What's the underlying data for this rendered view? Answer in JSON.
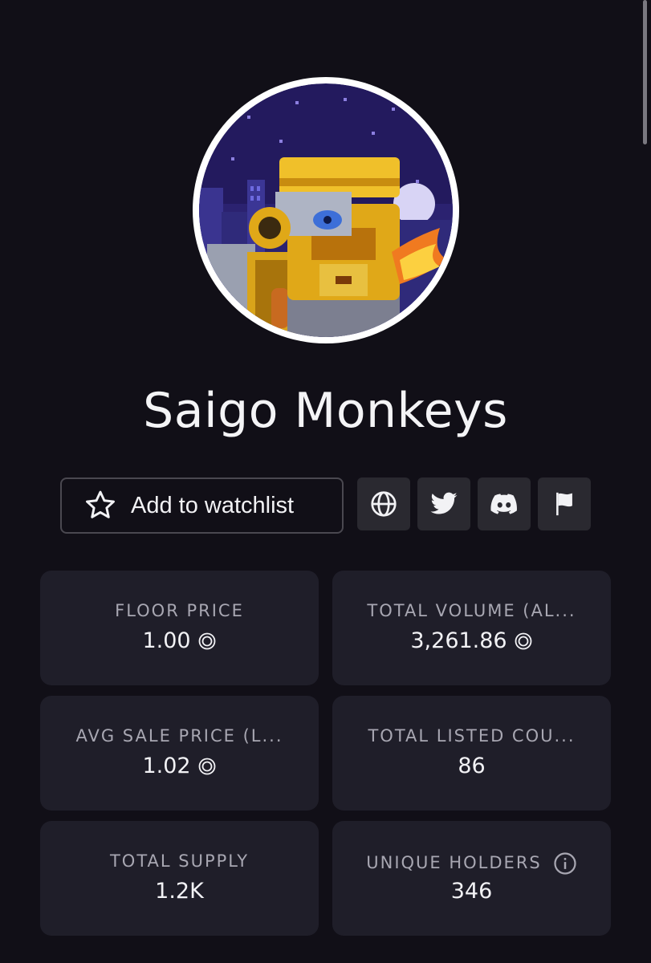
{
  "collection": {
    "name": "Saigo Monkeys",
    "avatar_icon": "pixel-art-monkey-avatar"
  },
  "actions": {
    "watchlist_label": "Add to watchlist",
    "website_icon": "globe-icon",
    "twitter_icon": "twitter-icon",
    "discord_icon": "discord-icon",
    "report_icon": "flag-icon"
  },
  "stats": [
    {
      "label": "FLOOR PRICE",
      "value": "1.00",
      "currency_icon": "sol-coin-icon"
    },
    {
      "label": "TOTAL VOLUME (AL...",
      "value": "3,261.86",
      "currency_icon": "sol-coin-icon"
    },
    {
      "label": "AVG SALE PRICE (L...",
      "value": "1.02",
      "currency_icon": "sol-coin-icon"
    },
    {
      "label": "TOTAL LISTED COU...",
      "value": "86"
    },
    {
      "label": "TOTAL SUPPLY",
      "value": "1.2K"
    },
    {
      "label": "UNIQUE HOLDERS",
      "value": "346",
      "info_icon": "info-icon"
    }
  ],
  "colors": {
    "background": "#110f17",
    "card": "#1f1e29",
    "icon_button": "#2a2930",
    "label": "#a8a7b2",
    "text": "#f2f2f5"
  }
}
